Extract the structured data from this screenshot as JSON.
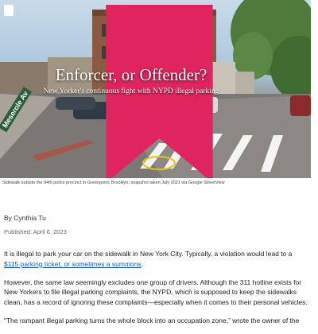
{
  "hero": {
    "title": "Enforcer, or Offender?",
    "subtitle": "New Yorker's continuous fight with NYPD illegal parking",
    "street_sign": "Meserole Av"
  },
  "caption": "Sidewalk outside the 94th police precinct in Greenpoint, Brooklyn; snapshot taken July 2021 via Google StreetView",
  "byline": "By Cynthia Tu",
  "published": "Published: April 6, 2023",
  "article": {
    "p1_before": "It is illegal to park your car on the sidewalk in New York City. Typically, a violation would lead to a ",
    "p1_link": "$115 parking ticket, or sometimes a summons",
    "p1_after": ".",
    "p2": "However, the same law seemingly excludes one group of drivers. Although the 311 hotline exists for New Yorkers to file illegal parking complaints, the NYPD, which is supposed to keep the sidewalks clean, has a record of ignoring these complaints—especially when it comes to their personal vehicles.",
    "p3": "“The rampant illegal parking turns the whole block into an occupation zone,” wrote the owner of the"
  },
  "colors": {
    "link": "#1a5fb4",
    "bookmark": "#e0245e"
  },
  "icons": {
    "bookmark": "bookmark-icon"
  }
}
